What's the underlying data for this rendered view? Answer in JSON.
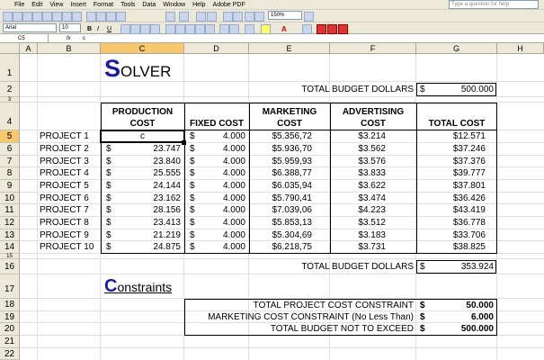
{
  "menu": [
    "File",
    "Edit",
    "View",
    "Insert",
    "Format",
    "Tools",
    "Data",
    "Window",
    "Help",
    "Adobe PDF"
  ],
  "help_placeholder": "Type a question for help",
  "toolbar": {
    "zoom": "150%",
    "font": "Arial",
    "font_size": "10"
  },
  "formula_bar": {
    "name_box": "C5",
    "fx": "fx",
    "content": "c"
  },
  "columns": [
    "A",
    "B",
    "C",
    "D",
    "E",
    "F",
    "G",
    "H"
  ],
  "rows": [
    "1",
    "2",
    "3",
    "4",
    "5",
    "6",
    "7",
    "8",
    "9",
    "10",
    "11",
    "12",
    "13",
    "14",
    "15",
    "16",
    "17",
    "18",
    "19",
    "20",
    "21",
    "22"
  ],
  "sheet": {
    "title_cap": "S",
    "title_rest": "OLVER",
    "budget_label": "TOTAL BUDGET DOLLARS",
    "budget_currency": "$",
    "budget_value": "500.000",
    "headers": {
      "production_1": "PRODUCTION",
      "production_2": "COST",
      "fixed": "FIXED COST",
      "marketing_1": "MARKETING",
      "marketing_2": "COST",
      "advertising_1": "ADVERTISING",
      "advertising_2": "COST",
      "total": "TOTAL COST"
    },
    "projects": [
      {
        "name": "PROJECT 1",
        "prod_cur": "",
        "prod": "c",
        "fix_cur": "$",
        "fix": "4.000",
        "mkt": "$5.356,72",
        "adv": "$3.214",
        "total": "$12.571"
      },
      {
        "name": "PROJECT 2",
        "prod_cur": "$",
        "prod": "23.747",
        "fix_cur": "$",
        "fix": "4.000",
        "mkt": "$5.936,70",
        "adv": "$3.562",
        "total": "$37.246"
      },
      {
        "name": "PROJECT 3",
        "prod_cur": "$",
        "prod": "23.840",
        "fix_cur": "$",
        "fix": "4.000",
        "mkt": "$5.959,93",
        "adv": "$3.576",
        "total": "$37.376"
      },
      {
        "name": "PROJECT 4",
        "prod_cur": "$",
        "prod": "25.555",
        "fix_cur": "$",
        "fix": "4.000",
        "mkt": "$6.388,77",
        "adv": "$3.833",
        "total": "$39.777"
      },
      {
        "name": "PROJECT 5",
        "prod_cur": "$",
        "prod": "24.144",
        "fix_cur": "$",
        "fix": "4.000",
        "mkt": "$6.035,94",
        "adv": "$3.622",
        "total": "$37.801"
      },
      {
        "name": "PROJECT 6",
        "prod_cur": "$",
        "prod": "23.162",
        "fix_cur": "$",
        "fix": "4.000",
        "mkt": "$5.790,41",
        "adv": "$3.474",
        "total": "$36.426"
      },
      {
        "name": "PROJECT 7",
        "prod_cur": "$",
        "prod": "28.156",
        "fix_cur": "$",
        "fix": "4.000",
        "mkt": "$7.039,06",
        "adv": "$4.223",
        "total": "$43.419"
      },
      {
        "name": "PROJECT 8",
        "prod_cur": "$",
        "prod": "23.413",
        "fix_cur": "$",
        "fix": "4.000",
        "mkt": "$5.853,13",
        "adv": "$3.512",
        "total": "$36.778"
      },
      {
        "name": "PROJECT 9",
        "prod_cur": "$",
        "prod": "21.219",
        "fix_cur": "$",
        "fix": "4.000",
        "mkt": "$5.304,69",
        "adv": "$3.183",
        "total": "$33.706"
      },
      {
        "name": "PROJECT 10",
        "prod_cur": "$",
        "prod": "24.875",
        "fix_cur": "$",
        "fix": "4.000",
        "mkt": "$6.218,75",
        "adv": "$3.731",
        "total": "$38.825"
      }
    ],
    "total_label": "TOTAL BUDGET DOLLARS",
    "total_currency": "$",
    "total_value": "353.924",
    "constraints_cap": "C",
    "constraints_rest": "onstraints",
    "constraints": [
      {
        "label": "TOTAL PROJECT COST CONSTRAINT",
        "currency": "$",
        "value": "50.000"
      },
      {
        "label": "MARKETING COST CONSTRAINT (No Less Than)",
        "currency": "$",
        "value": "6.000"
      },
      {
        "label": "TOTAL BUDGET NOT TO EXCEED",
        "currency": "$",
        "value": "500.000"
      }
    ]
  },
  "colors": {
    "title_blue": "#1a1aa6",
    "active_header": "#f7c86d",
    "chrome": "#ece9d8"
  }
}
